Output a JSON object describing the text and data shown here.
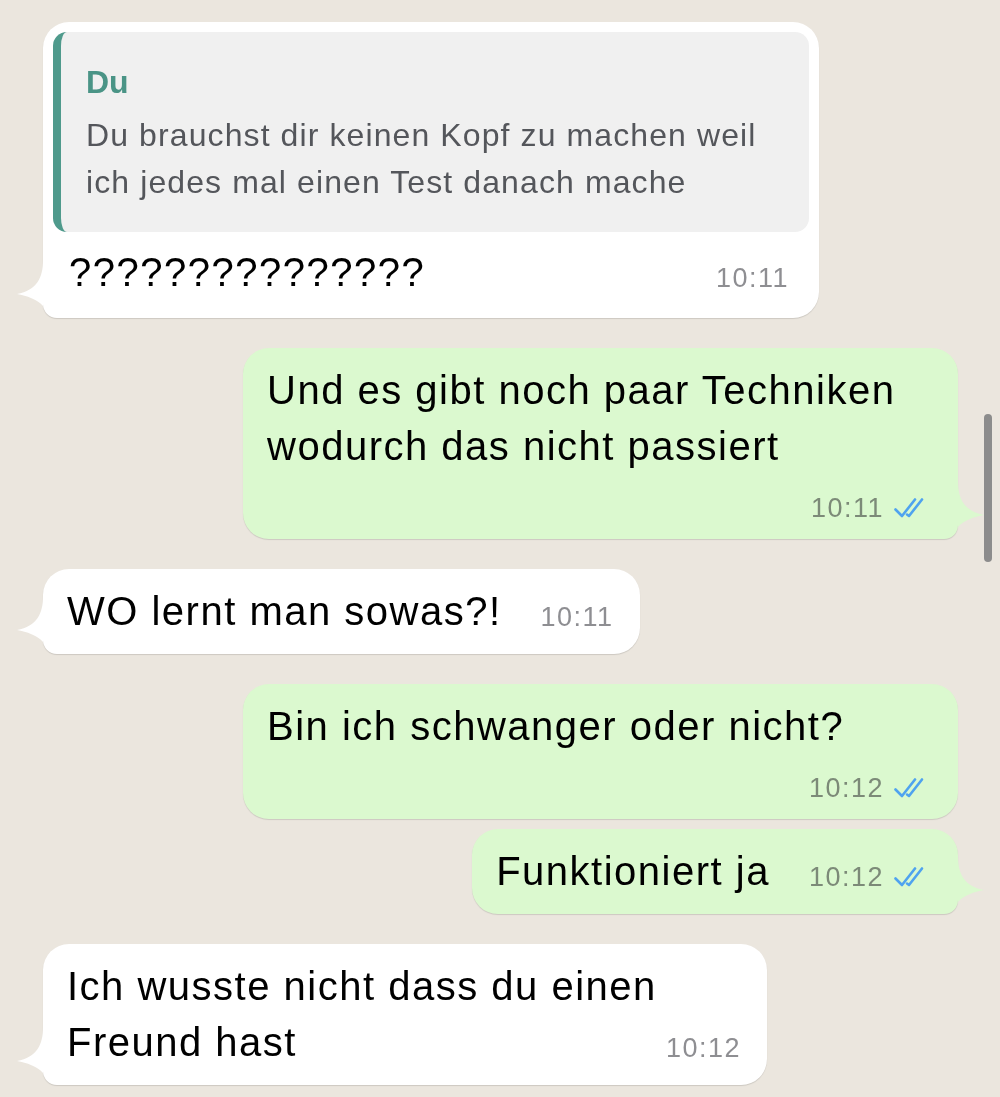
{
  "messages": [
    {
      "kind": "incoming",
      "quote": {
        "author": "Du",
        "text": "Du brauchst dir keinen Kopf zu machen weil ich jedes mal einen Test danach mache"
      },
      "text": "???????????????",
      "time": "10:11",
      "tail": true
    },
    {
      "kind": "outgoing",
      "text": "Und es gibt noch paar Techniken wodurch das nicht passiert",
      "time": "10:11",
      "read": true,
      "tail": true
    },
    {
      "kind": "incoming",
      "text": "WO lernt man sowas?!",
      "time": "10:11",
      "tail": true
    },
    {
      "kind": "outgoing",
      "text": "Bin ich schwanger oder nicht?",
      "time": "10:12",
      "read": true,
      "tail": false
    },
    {
      "kind": "outgoing",
      "text": "Funktioniert ja",
      "time": "10:12",
      "read": true,
      "tail": true
    },
    {
      "kind": "incoming",
      "text": "Ich wusste nicht dass du einen Freund hast",
      "time": "10:12",
      "tail": true
    }
  ]
}
